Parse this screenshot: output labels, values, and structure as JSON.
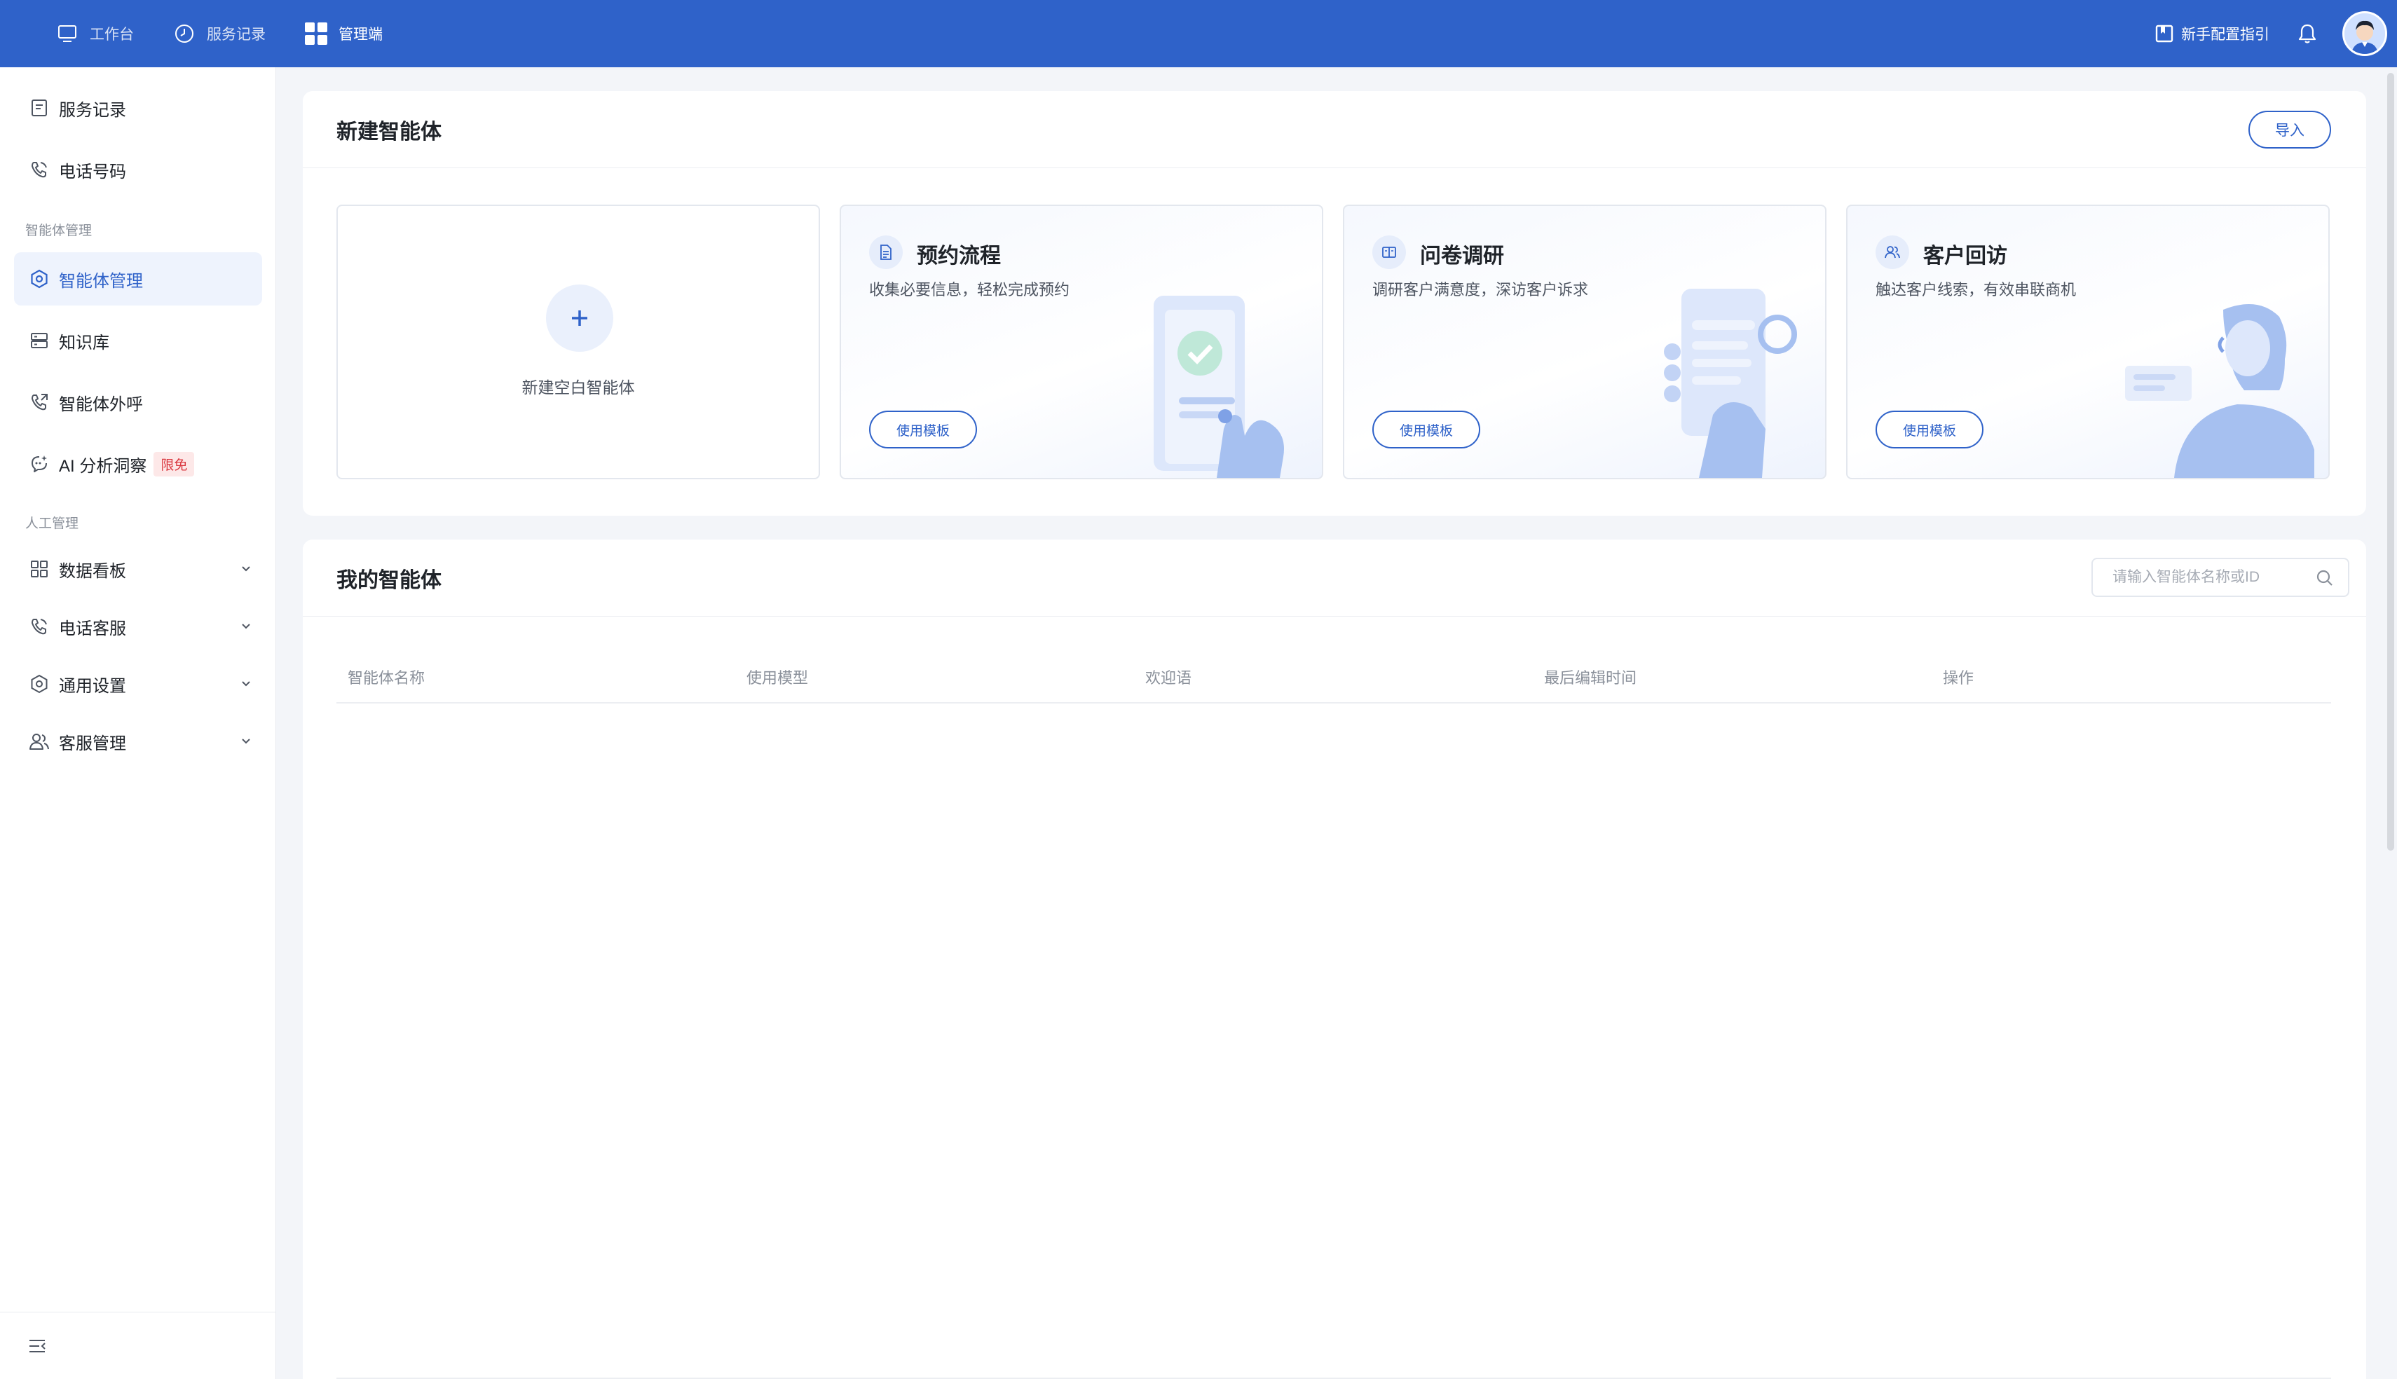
{
  "topnav": {
    "items": [
      {
        "label": "工作台",
        "icon": "monitor-icon"
      },
      {
        "label": "服务记录",
        "icon": "clock-icon"
      },
      {
        "label": "管理端",
        "icon": "grid-icon",
        "active": true
      }
    ],
    "guide_label": "新手配置指引",
    "brand_color": "#2f62c9"
  },
  "sidebar": {
    "items": [
      {
        "label": "服务记录",
        "icon": "document-icon"
      },
      {
        "label": "电话号码",
        "icon": "phone-icon"
      }
    ],
    "section_agent": "智能体管理",
    "agent_items": [
      {
        "label": "智能体管理",
        "icon": "hexagon-gear-icon",
        "active": true
      },
      {
        "label": "知识库",
        "icon": "database-icon"
      },
      {
        "label": "智能体外呼",
        "icon": "phone-out-icon"
      },
      {
        "label": "AI 分析洞察",
        "icon": "chat-sparkle-icon",
        "badge": "限免"
      }
    ],
    "section_manual": "人工管理",
    "manual_items": [
      {
        "label": "数据看板",
        "icon": "dashboard-icon"
      },
      {
        "label": "电话客服",
        "icon": "phone-icon"
      },
      {
        "label": "通用设置",
        "icon": "gear-icon"
      },
      {
        "label": "客服管理",
        "icon": "users-icon"
      }
    ]
  },
  "create_panel": {
    "title": "新建智能体",
    "import_label": "导入",
    "blank_label": "新建空白智能体",
    "templates": [
      {
        "title": "预约流程",
        "desc": "收集必要信息，轻松完成预约",
        "button": "使用模板",
        "icon": "document-icon"
      },
      {
        "title": "问卷调研",
        "desc": "调研客户满意度，深访客户诉求",
        "button": "使用模板",
        "icon": "book-icon"
      },
      {
        "title": "客户回访",
        "desc": "触达客户线索，有效串联商机",
        "button": "使用模板",
        "icon": "users-icon"
      }
    ]
  },
  "my_panel": {
    "title": "我的智能体",
    "search_placeholder": "请输入智能体名称或ID",
    "columns": [
      "智能体名称",
      "使用模型",
      "欢迎语",
      "最后编辑时间",
      "操作"
    ]
  }
}
